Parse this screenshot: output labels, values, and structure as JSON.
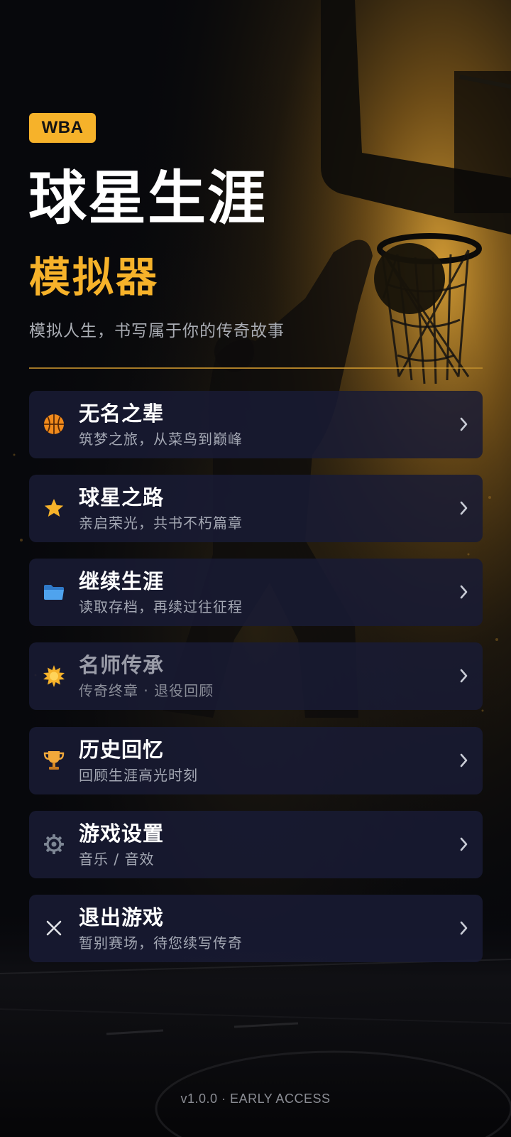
{
  "header": {
    "badge": "WBA",
    "title": "球星生涯",
    "subtitle": "模拟器",
    "tagline": "模拟人生，书写属于你的传奇故事"
  },
  "menu": [
    {
      "label": "无名之辈",
      "sub": "筑梦之旅，从菜鸟到巅峰",
      "icon": "basketball-icon",
      "enabled": true
    },
    {
      "label": "球星之路",
      "sub": "亲启荣光，共书不朽篇章",
      "icon": "star-icon",
      "enabled": true
    },
    {
      "label": "继续生涯",
      "sub": "读取存档，再续过往征程",
      "icon": "folder-icon",
      "enabled": true
    },
    {
      "label": "名师传承",
      "sub": "传奇终章 · 退役回顾",
      "icon": "sunburst-icon",
      "enabled": false
    },
    {
      "label": "历史回忆",
      "sub": "回顾生涯高光时刻",
      "icon": "trophy-icon",
      "enabled": true
    },
    {
      "label": "游戏设置",
      "sub": "音乐 / 音效",
      "icon": "gear-icon",
      "enabled": true
    },
    {
      "label": "退出游戏",
      "sub": "暂别赛场，待您续写传奇",
      "icon": "close-icon",
      "enabled": true
    }
  ],
  "footer": {
    "version": "v1.0.0 · EARLY ACCESS"
  },
  "colors": {
    "accent": "#f6b22a",
    "card": "#181b34",
    "background": "#07080c"
  }
}
